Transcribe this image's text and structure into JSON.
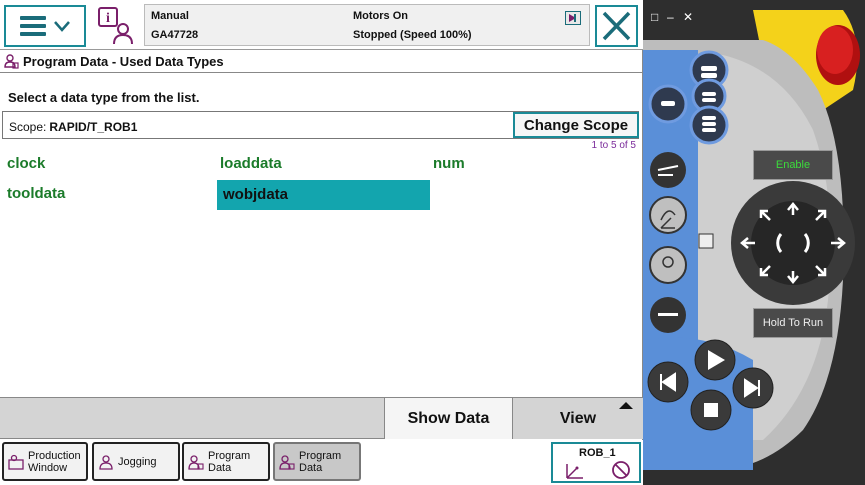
{
  "status": {
    "mode": "Manual",
    "controller_id": "GA47728",
    "motors": "Motors On",
    "state": "Stopped (Speed 100%)"
  },
  "title": "Program Data - Used Data Types",
  "instruction": "Select a data type from the list.",
  "scope": {
    "label": "Scope:",
    "value": "RAPID/T_ROB1",
    "change_button": "Change Scope"
  },
  "page_count": "1 to 5 of 5",
  "data_types": [
    "clock",
    "loaddata",
    "num",
    "tooldata",
    "wobjdata"
  ],
  "selected_data_type": "wobjdata",
  "bottom": {
    "show_data": "Show Data",
    "view": "View"
  },
  "taskbar": [
    {
      "line1": "Production",
      "line2": "Window"
    },
    {
      "line1": "Jogging",
      "line2": ""
    },
    {
      "line1": "Program",
      "line2": "Data"
    },
    {
      "line1": "Program",
      "line2": "Data"
    }
  ],
  "robot": "ROB_1",
  "device": {
    "enable": "Enable",
    "hold_to_run": "Hold To Run",
    "window_controls": [
      "□",
      "–",
      "✕"
    ]
  },
  "colors": {
    "accent": "#1a8a96",
    "selection": "#13a5ae",
    "data_type_text": "#1b7b2a",
    "device_blue": "#5a8fd8",
    "device_yellow": "#f4d21a",
    "device_red": "#d01818"
  }
}
